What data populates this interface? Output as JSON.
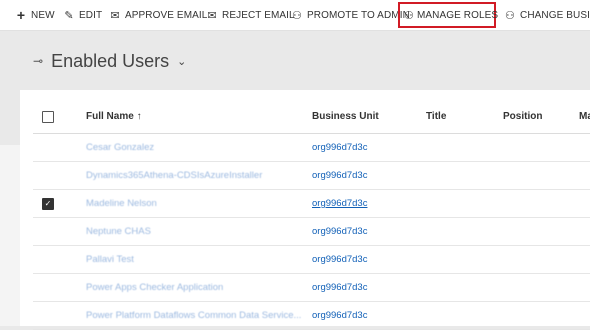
{
  "commands": [
    {
      "icon": "plus-icon",
      "glyph": "+",
      "label": "NEW"
    },
    {
      "icon": "edit-icon",
      "glyph": "✎",
      "label": "EDIT"
    },
    {
      "icon": "approve-email-icon",
      "glyph": "✉",
      "label": "APPROVE EMAIL"
    },
    {
      "icon": "reject-email-icon",
      "glyph": "✉",
      "label": "REJECT EMAIL"
    },
    {
      "icon": "promote-admin-icon",
      "glyph": "⚇",
      "label": "PROMOTE TO ADMIN"
    },
    {
      "icon": "manage-roles-icon",
      "glyph": "⚇",
      "label": "MANAGE ROLES"
    },
    {
      "icon": "change-business-unit-icon",
      "glyph": "⚇",
      "label": "CHANGE BUSINES"
    }
  ],
  "view": {
    "pin_glyph": "⊸",
    "title": "Enabled Users",
    "chevron": "⌄"
  },
  "grid": {
    "columns": [
      "Full Name ↑",
      "Business Unit",
      "Title",
      "Position",
      "Ma"
    ],
    "rows": [
      {
        "name": "Cesar Gonzalez",
        "bu": "org996d7d3c",
        "checked": false,
        "bu_underline": false
      },
      {
        "name": "Dynamics365Athena-CDSIsAzureInstaller",
        "bu": "org996d7d3c",
        "checked": false,
        "bu_underline": false
      },
      {
        "name": "Madeline Nelson",
        "bu": "org996d7d3c",
        "checked": true,
        "bu_underline": true
      },
      {
        "name": "Neptune CHAS",
        "bu": "org996d7d3c",
        "checked": false,
        "bu_underline": false
      },
      {
        "name": "Pallavi Test",
        "bu": "org996d7d3c",
        "checked": false,
        "bu_underline": false
      },
      {
        "name": "Power Apps Checker Application",
        "bu": "org996d7d3c",
        "checked": false,
        "bu_underline": false
      },
      {
        "name": "Power Platform Dataflows Common Data Service...",
        "bu": "org996d7d3c",
        "checked": false,
        "bu_underline": false
      }
    ]
  },
  "colors": {
    "highlight": "#d11b25",
    "link": "#1160b7"
  }
}
